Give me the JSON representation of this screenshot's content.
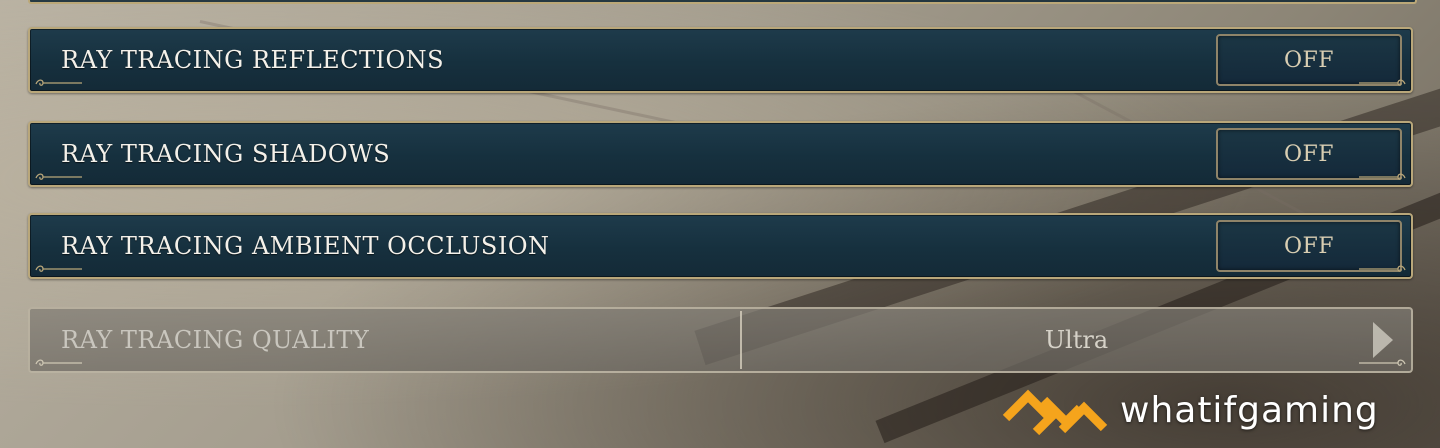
{
  "settings": [
    {
      "label": "RAY TRACING REFLECTIONS",
      "value": "OFF",
      "enabled": true
    },
    {
      "label": "RAY TRACING SHADOWS",
      "value": "OFF",
      "enabled": true
    },
    {
      "label": "RAY TRACING AMBIENT OCCLUSION",
      "value": "OFF",
      "enabled": true
    },
    {
      "label": "RAY TRACING QUALITY",
      "value": "Ultra",
      "enabled": false
    }
  ],
  "watermark": {
    "text": "whatifgaming",
    "brand_color": "#f5a41c"
  },
  "colors": {
    "row_bg": "#16303e",
    "row_border": "#b9a77a",
    "label_text": "#f4f1ea",
    "toggle_text": "#d9ceb2"
  }
}
